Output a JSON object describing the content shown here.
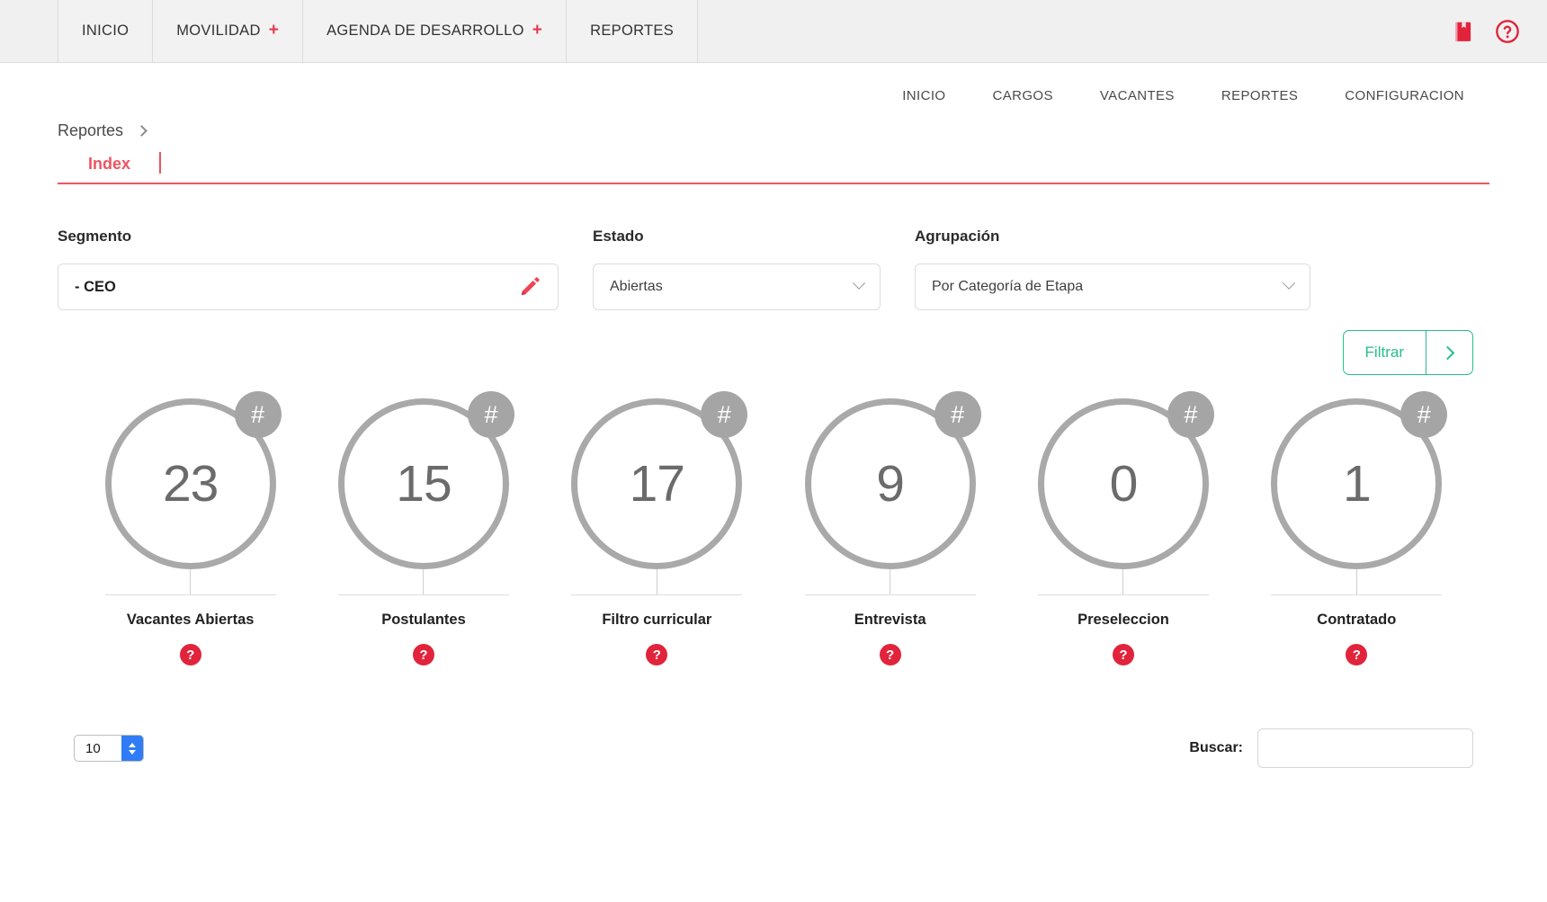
{
  "topnav": {
    "items": [
      {
        "label": "INICIO",
        "has_plus": false
      },
      {
        "label": "MOVILIDAD",
        "has_plus": true,
        "plus": "+"
      },
      {
        "label": "AGENDA DE DESARROLLO",
        "has_plus": true,
        "plus": "+"
      },
      {
        "label": "REPORTES",
        "has_plus": false
      }
    ],
    "icons": [
      {
        "name": "manual-book-icon"
      },
      {
        "name": "help-circle-icon"
      }
    ]
  },
  "subnav": {
    "items": [
      "INICIO",
      "CARGOS",
      "VACANTES",
      "REPORTES",
      "CONFIGURACION"
    ]
  },
  "breadcrumb": {
    "items": [
      "Reportes"
    ]
  },
  "tabs": {
    "items": [
      {
        "label": "Index",
        "active": true
      }
    ]
  },
  "filters": {
    "segmento": {
      "label": "Segmento",
      "value": "- CEO",
      "edit_icon": "pencil-icon"
    },
    "estado": {
      "label": "Estado",
      "value": "Abiertas"
    },
    "agrupacion": {
      "label": "Agrupación",
      "value": "Por Categoría de Etapa"
    },
    "filter_button": {
      "label": "Filtrar",
      "arrow": "chevron-right-icon"
    }
  },
  "metrics": [
    {
      "value": "23",
      "label": "Vacantes Abiertas",
      "badge": "#",
      "help": "?"
    },
    {
      "value": "15",
      "label": "Postulantes",
      "badge": "#",
      "help": "?"
    },
    {
      "value": "17",
      "label": "Filtro curricular",
      "badge": "#",
      "help": "?"
    },
    {
      "value": "9",
      "label": "Entrevista",
      "badge": "#",
      "help": "?"
    },
    {
      "value": "0",
      "label": "Preseleccion",
      "badge": "#",
      "help": "?"
    },
    {
      "value": "1",
      "label": "Contratado",
      "badge": "#",
      "help": "?"
    }
  ],
  "table_controls": {
    "page_size": "10",
    "search_label": "Buscar:",
    "search_value": "",
    "search_placeholder": ""
  },
  "colors": {
    "accent_red": "#ef5360",
    "icon_red": "#e1243b",
    "filter_green": "#24c08a",
    "ring_gray": "#a9a9a9",
    "badge_gray": "#a5a5a5",
    "topbar_bg": "#f0f0f0",
    "stepper_blue": "#2f7cf6"
  }
}
